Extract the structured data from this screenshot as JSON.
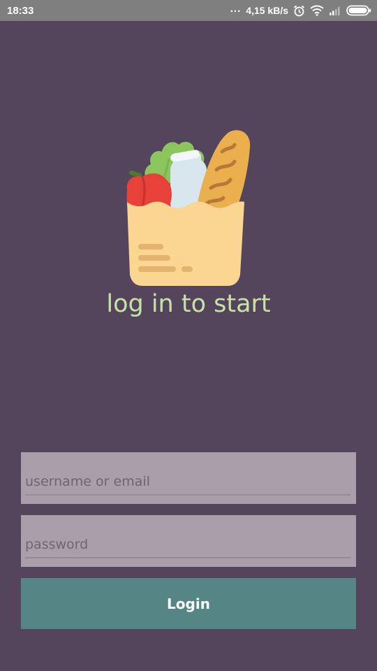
{
  "status_bar": {
    "time": "18:33",
    "dots": "...",
    "network_speed": "4,15 kB/s",
    "icons": [
      "alarm-icon",
      "wifi-icon",
      "signal-icon",
      "battery-icon"
    ]
  },
  "logo": {
    "icon": "grocery-bag-icon"
  },
  "tagline": "log in to start",
  "form": {
    "username_placeholder": "username or email",
    "password_placeholder": "password",
    "login_label": "Login"
  },
  "colors": {
    "background": "#55455c",
    "tagline": "#c5e3a5",
    "field_background": "#ab9eab",
    "button": "#568585",
    "status_bar": "#7f7f7f"
  }
}
